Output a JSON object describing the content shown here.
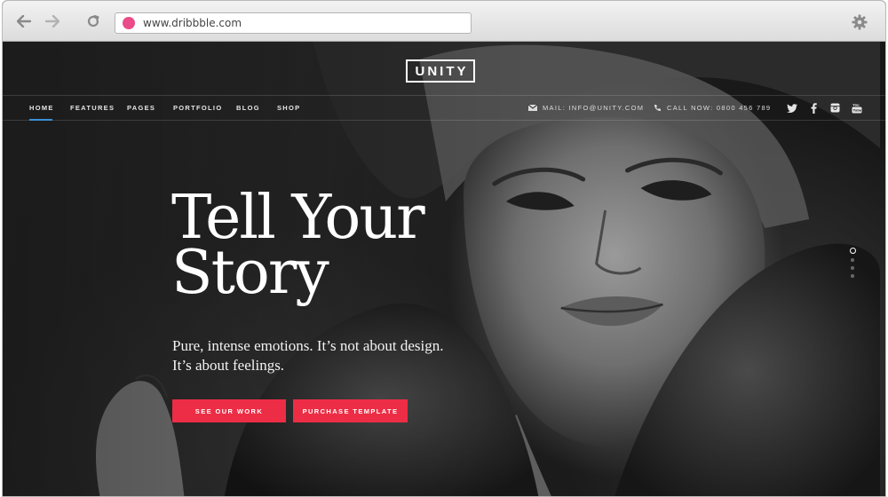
{
  "browser": {
    "url": "www.dribbble.com",
    "back_icon": "arrow-left-icon",
    "forward_icon": "arrow-right-icon",
    "reload_icon": "reload-icon",
    "settings_icon": "gear-icon",
    "favicon_color": "#ea4c89"
  },
  "site": {
    "logo": "UNITY",
    "nav": {
      "items": [
        "HOME",
        "FEATURES",
        "PAGES",
        "PORTFOLIO",
        "BLOG",
        "SHOP"
      ],
      "active": "HOME",
      "active_color": "#3a8fd6"
    },
    "contact": {
      "mail": "MAIL: INFO@UNITY.COM",
      "phone": "CALL NOW: 0800  456  789"
    },
    "social": [
      "twitter-icon",
      "facebook-icon",
      "instagram-icon",
      "youtube-icon"
    ],
    "hero": {
      "headline_line1": "Tell Your",
      "headline_line2": "Story",
      "tagline_line1": "Pure, intense emotions. It’s not about design.",
      "tagline_line2": "It’s about feelings.",
      "primary_button": "SEE OUR WORK",
      "secondary_button": "PURCHASE TEMPLATE",
      "button_color": "#ec2d45"
    },
    "slider": {
      "dot_count": 4,
      "active_index": 0
    }
  }
}
